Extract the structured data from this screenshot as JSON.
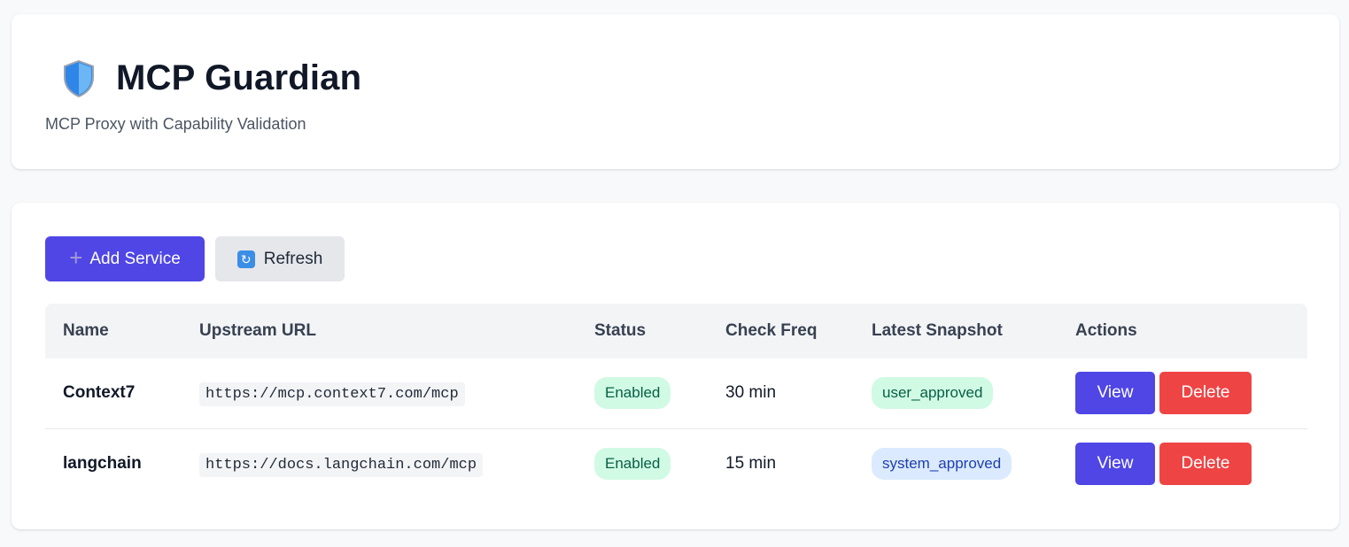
{
  "header": {
    "title": "MCP Guardian",
    "subtitle": "MCP Proxy with Capability Validation",
    "icon": "shield-icon"
  },
  "toolbar": {
    "add_label": "Add Service",
    "add_icon": "+",
    "refresh_label": "Refresh",
    "refresh_icon": "↻"
  },
  "table": {
    "columns": [
      "Name",
      "Upstream URL",
      "Status",
      "Check Freq",
      "Latest Snapshot",
      "Actions"
    ],
    "rows": [
      {
        "name": "Context7",
        "url": "https://mcp.context7.com/mcp",
        "status": "Enabled",
        "freq": "30 min",
        "snapshot": "user_approved",
        "view_label": "View",
        "delete_label": "Delete"
      },
      {
        "name": "langchain",
        "url": "https://docs.langchain.com/mcp",
        "status": "Enabled",
        "freq": "15 min",
        "snapshot": "system_approved",
        "view_label": "View",
        "delete_label": "Delete"
      }
    ]
  },
  "colors": {
    "primary": "#4f46e5",
    "danger": "#ef4444",
    "status_enabled_bg": "#d1fae5",
    "snapshot_user_bg": "#d1fae5",
    "snapshot_system_bg": "#dbeafe"
  }
}
